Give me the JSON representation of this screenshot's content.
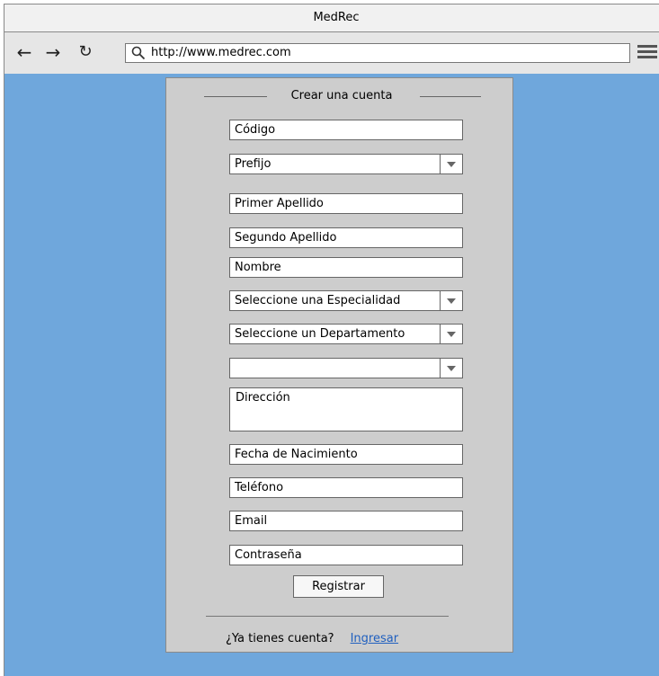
{
  "window": {
    "title": "MedRec"
  },
  "toolbar": {
    "url": "http://www.medrec.com",
    "back_icon": "arrow-left-icon",
    "forward_icon": "arrow-right-icon",
    "reload_icon": "reload-icon",
    "menu_icon": "hamburger-menu-icon"
  },
  "form": {
    "title": "Crear una cuenta",
    "codigo": "Código",
    "prefijo": "Prefijo",
    "primer_apellido": "Primer Apellido",
    "segundo_apellido": "Segundo Apellido",
    "nombre": "Nombre",
    "especialidad": "Seleccione una Especialidad",
    "departamento": "Seleccione un Departamento",
    "municipio": "",
    "direccion": "Dirección",
    "fecha_nacimiento": "Fecha de Nacimiento",
    "telefono": "Teléfono",
    "email": "Email",
    "contrasena": "Contraseña",
    "submit_label": "Registrar"
  },
  "footer": {
    "question": "¿Ya tienes cuenta?",
    "login_link": "Ingresar"
  },
  "colors": {
    "background": "#6fa7dc",
    "panel": "#cdcdcd",
    "link": "#1f5fbf"
  }
}
